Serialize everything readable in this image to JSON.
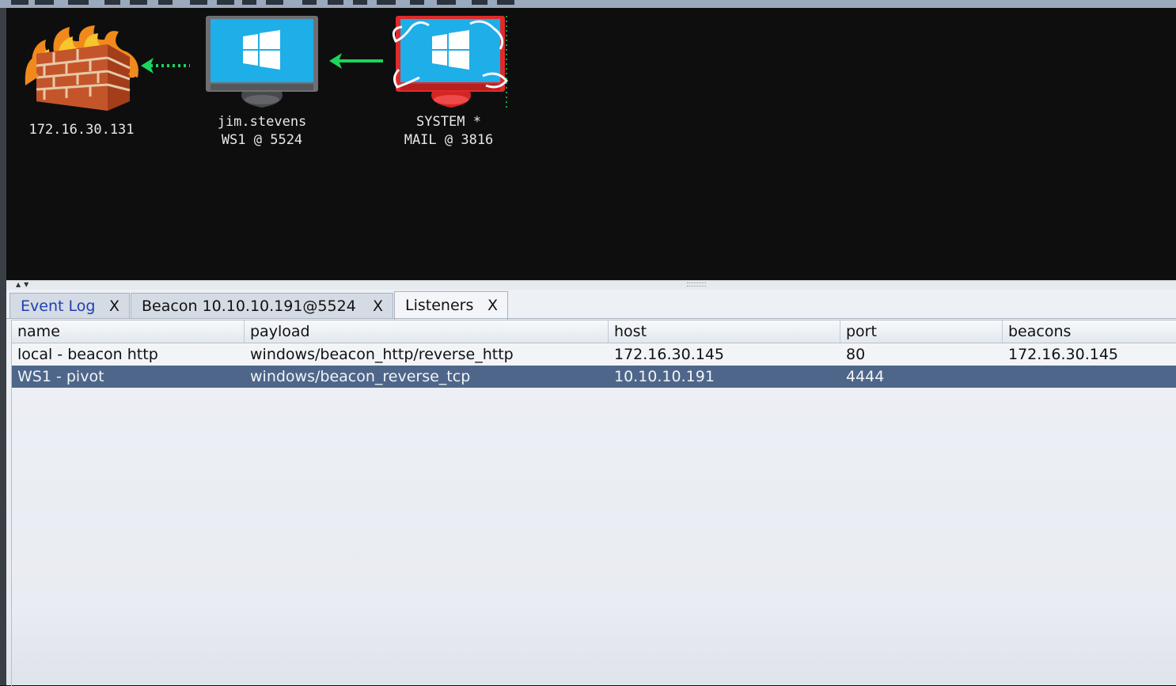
{
  "graph": {
    "nodes": [
      {
        "id": "firewall",
        "icon": "firewall-icon",
        "lines": [
          "172.16.30.131"
        ]
      },
      {
        "id": "ws1",
        "icon": "windows-monitor-icon",
        "lines": [
          "jim.stevens",
          "WS1 @ 5524"
        ]
      },
      {
        "id": "mail",
        "icon": "windows-monitor-compromised-icon",
        "lines": [
          "SYSTEM *",
          "MAIL @ 3816"
        ]
      }
    ],
    "colors": {
      "arrow": "#1bd65a",
      "monitor_screen": "#1eaee8",
      "compromised": "#e02a2a"
    }
  },
  "tabs": [
    {
      "label": "Event Log",
      "close": "X"
    },
    {
      "label": "Beacon 10.10.10.191@5524",
      "close": "X"
    },
    {
      "label": "Listeners",
      "close": "X"
    }
  ],
  "table": {
    "columns": [
      "name",
      "payload",
      "host",
      "port",
      "beacons"
    ],
    "rows": [
      [
        "local - beacon http",
        "windows/beacon_http/reverse_http",
        "172.16.30.145",
        "80",
        "172.16.30.145"
      ],
      [
        "WS1 - pivot",
        "windows/beacon_reverse_tcp",
        "10.10.10.191",
        "4444",
        ""
      ]
    ]
  }
}
